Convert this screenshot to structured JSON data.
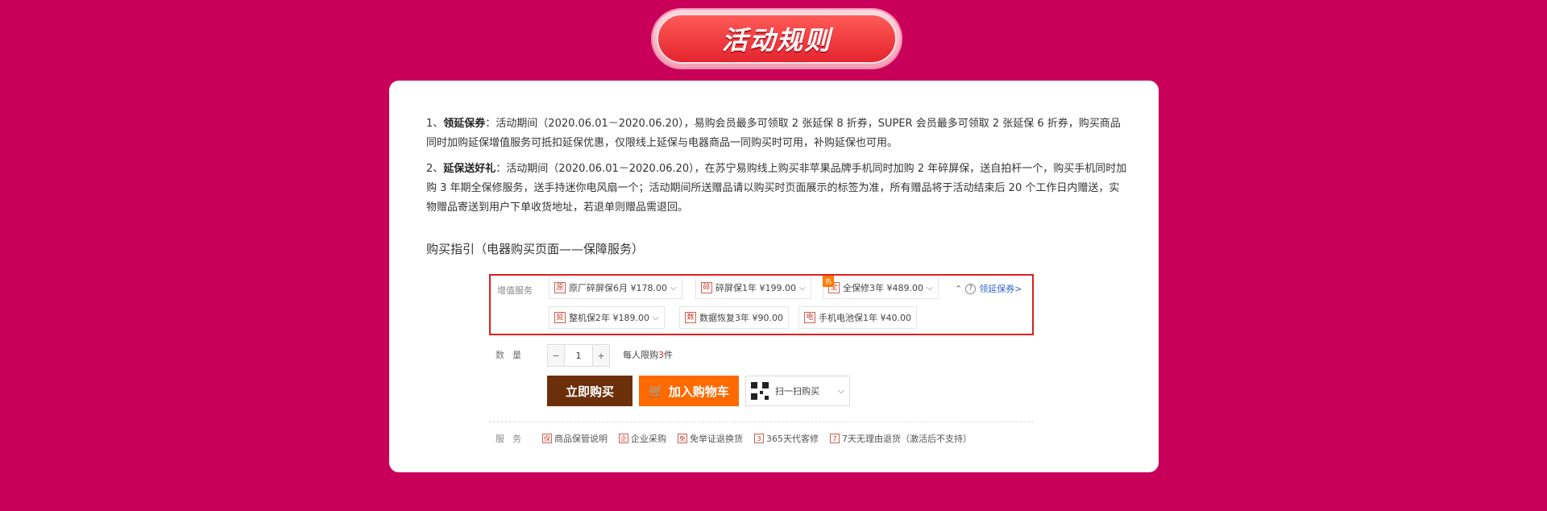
{
  "header": {
    "title": "活动规则"
  },
  "rules": [
    {
      "num": "1、",
      "heading": "领延保券",
      "body": "：活动期间（2020.06.01－2020.06.20），易购会员最多可领取 2 张延保 8 折券，SUPER 会员最多可领取 2 张延保 6 折券，购买商品同时加购延保增值服务可抵扣延保优惠，仅限线上延保与电器商品一同购买时可用，补购延保也可用。"
    },
    {
      "num": "2、",
      "heading": "延保送好礼",
      "body": "：活动期间（2020.06.01－2020.06.20），在苏宁易购线上购买非苹果品牌手机同时加购 2 年碎屏保，送自拍杆一个，购买手机同时加购 3 年期全保修服务，送手持迷你电风扇一个；活动期间所送赠品请以购买时页面展示的标签为准，所有赠品将于活动结束后 20 个工作日内赠送，实物赠品寄送到用户下单收货地址，若退单则赠品需退回。"
    }
  ],
  "guide_title": "购买指引（电器购买页面——保障服务）",
  "screenshot": {
    "services_label": "增值服务",
    "options": [
      {
        "icon": "原",
        "label": "原厂碎屏保6月 ¥178.00"
      },
      {
        "icon": "碎",
        "label": "碎屏保1年 ¥199.00"
      },
      {
        "icon": "全",
        "label": "全保修3年 ¥489.00"
      },
      {
        "icon": "延",
        "label": "整机保2年 ¥189.00"
      },
      {
        "icon": "数",
        "label": "数据恢复3年 ¥90.00"
      },
      {
        "icon": "电",
        "label": "手机电池保1年 ¥40.00"
      }
    ],
    "hot_badge": "热",
    "coupon_link": "领延保券>",
    "qty_label": "数量",
    "qty_minus": "−",
    "qty_value": "1",
    "qty_plus": "+",
    "limit_prefix": "每人限购",
    "limit_num": "3",
    "limit_suffix": "件",
    "buy_now": "立即购买",
    "add_cart": "加入购物车",
    "scan": "扫一扫购买",
    "service_label": "服务",
    "services": [
      {
        "icon": "保",
        "label": "商品保管说明"
      },
      {
        "icon": "企",
        "label": "企业采购"
      },
      {
        "icon": "免",
        "label": "免举证退换货"
      },
      {
        "icon": "3",
        "label": "365天代客修"
      },
      {
        "icon": "7",
        "label": "7天无理由退货（激活后不支持）"
      }
    ]
  }
}
